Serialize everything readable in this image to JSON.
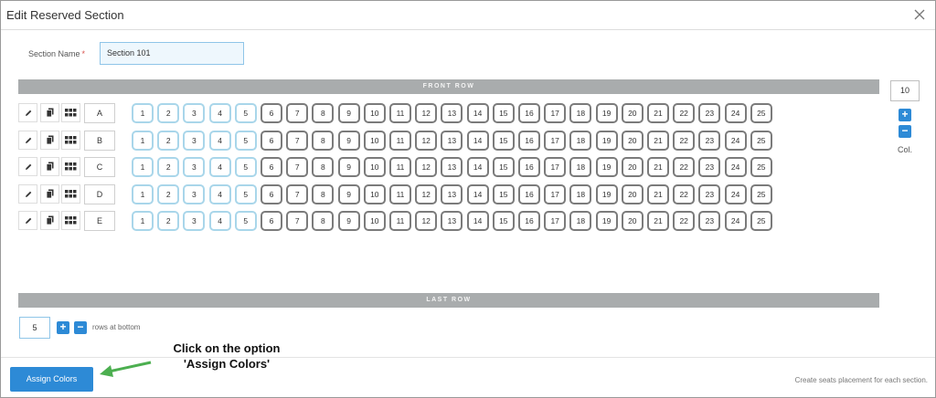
{
  "dialog": {
    "title": "Edit Reserved Section",
    "close_icon": "close-icon"
  },
  "section_name": {
    "label": "Section Name",
    "required_mark": "*",
    "value": "Section 101"
  },
  "bands": {
    "front": "FRONT ROW",
    "last": "LAST ROW"
  },
  "rows": [
    {
      "label": "A"
    },
    {
      "label": "B"
    },
    {
      "label": "C"
    },
    {
      "label": "D"
    },
    {
      "label": "E"
    }
  ],
  "row_tools": [
    "pencil-icon",
    "copy-icon",
    "grid-icon"
  ],
  "seats": [
    "1",
    "2",
    "3",
    "4",
    "5",
    "6",
    "7",
    "8",
    "9",
    "10",
    "11",
    "12",
    "13",
    "14",
    "15",
    "16",
    "17",
    "18",
    "19",
    "20",
    "21",
    "22",
    "23",
    "24",
    "25"
  ],
  "highlighted_seat_count": 5,
  "columns": {
    "value": "10",
    "plus": "+",
    "minus": "−",
    "label": "Col."
  },
  "bottom_rows": {
    "value": "5",
    "plus": "+",
    "minus": "−",
    "label": "rows at bottom"
  },
  "footer": {
    "assign_button": "Assign Colors",
    "note": "Create seats placement for each section."
  },
  "annotation": {
    "line1": "Click on the option",
    "line2": "'Assign Colors'"
  },
  "colors": {
    "accent": "#2d8ad6",
    "seat_highlight_border": "#a9d6ea",
    "seat_border": "#7b7b7b",
    "band": "#a9acad",
    "arrow": "#4caf50"
  }
}
